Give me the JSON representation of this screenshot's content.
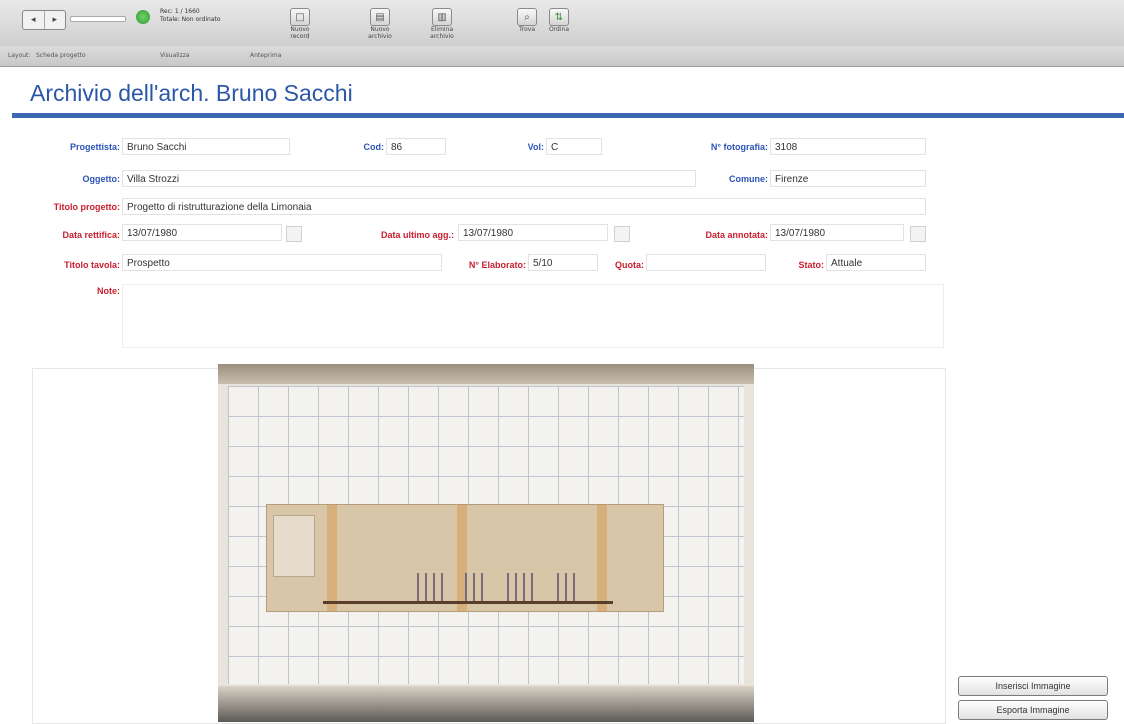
{
  "toolbar": {
    "record_info_line1": "Rec: 1 / 1660",
    "record_info_line2": "Totale: Non ordinato",
    "buttons": [
      "Nuovo record",
      "Nuovo archivio",
      "Elimina archivio",
      "Trova",
      "Ordina"
    ]
  },
  "subbar": {
    "layout_label": "Layout:",
    "layout_value": "Scheda progetto",
    "view_label": "Visualizza",
    "preview_label": "Anteprima"
  },
  "header": {
    "title": "Archivio dell'arch. Bruno Sacchi"
  },
  "form": {
    "progettista": {
      "label": "Progettista:",
      "value": "Bruno Sacchi"
    },
    "cod": {
      "label": "Cod:",
      "value": "86"
    },
    "vol": {
      "label": "Vol:",
      "value": "C"
    },
    "n_fotografia": {
      "label": "N° fotografia:",
      "value": "3108"
    },
    "oggetto": {
      "label": "Oggetto:",
      "value": "Villa Strozzi"
    },
    "comune": {
      "label": "Comune:",
      "value": "Firenze"
    },
    "titolo_progetto": {
      "label": "Titolo progetto:",
      "value": "Progetto di ristrutturazione della Limonaia"
    },
    "data_rettifica": {
      "label": "Data rettifica:",
      "value": "13/07/1980"
    },
    "data_ultimo_agg": {
      "label": "Data ultimo agg.:",
      "value": "13/07/1980"
    },
    "data_annotata": {
      "label": "Data annotata:",
      "value": "13/07/1980"
    },
    "titolo_tavola": {
      "label": "Titolo tavola:",
      "value": "Prospetto"
    },
    "n_elaborato": {
      "label": "N° Elaborato:",
      "value": "5/10"
    },
    "quota": {
      "label": "Quota:",
      "value": ""
    },
    "stato": {
      "label": "Stato:",
      "value": "Attuale"
    },
    "note": {
      "label": "Note:",
      "value": ""
    }
  },
  "buttons": {
    "insert_image": "Inserisci Immagine",
    "export_image": "Esporta Immagine"
  }
}
